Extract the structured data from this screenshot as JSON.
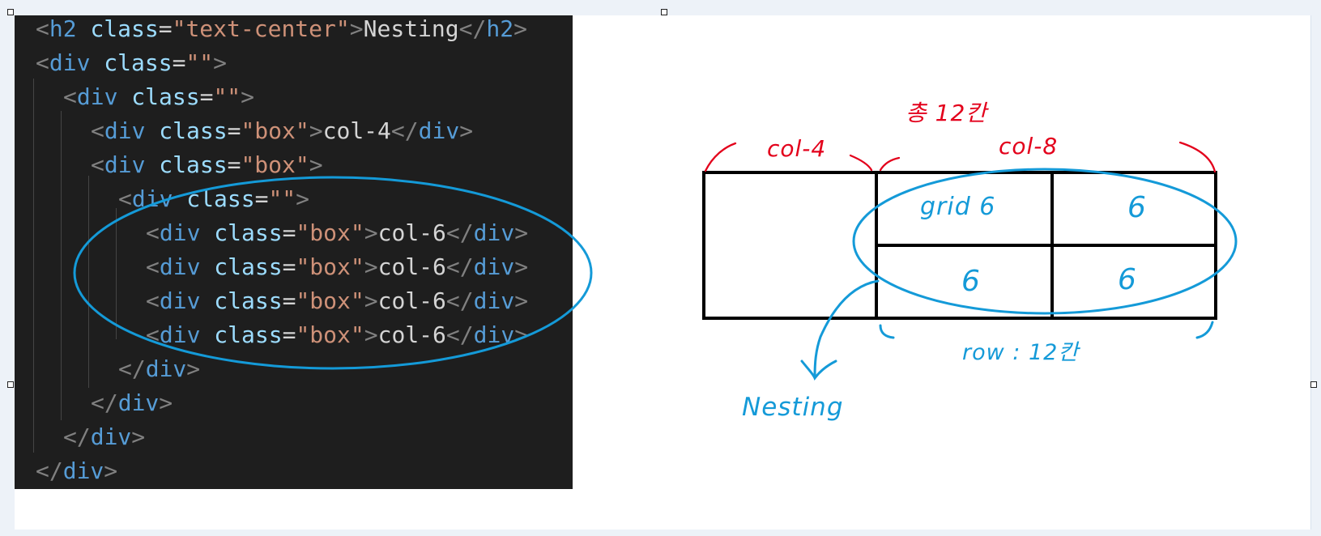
{
  "code": {
    "lines": [
      {
        "indent": 0,
        "tokens": [
          {
            "text": "<",
            "kind": "p"
          },
          {
            "text": "h2",
            "kind": "t"
          },
          {
            "text": " ",
            "kind": "x"
          },
          {
            "text": "class",
            "kind": "a"
          },
          {
            "text": "=",
            "kind": "x"
          },
          {
            "text": "\"text-center\"",
            "kind": "s"
          },
          {
            "text": ">",
            "kind": "p"
          },
          {
            "text": "Nesting",
            "kind": "x"
          },
          {
            "text": "</",
            "kind": "p"
          },
          {
            "text": "h2",
            "kind": "t"
          },
          {
            "text": ">",
            "kind": "p"
          }
        ]
      },
      {
        "indent": 0,
        "tokens": [
          {
            "text": "<",
            "kind": "p"
          },
          {
            "text": "div",
            "kind": "t"
          },
          {
            "text": " ",
            "kind": "x"
          },
          {
            "text": "class",
            "kind": "a"
          },
          {
            "text": "=",
            "kind": "x"
          },
          {
            "text": "\"\"",
            "kind": "s"
          },
          {
            "text": ">",
            "kind": "p"
          }
        ]
      },
      {
        "indent": 1,
        "tokens": [
          {
            "text": "<",
            "kind": "p"
          },
          {
            "text": "div",
            "kind": "t"
          },
          {
            "text": " ",
            "kind": "x"
          },
          {
            "text": "class",
            "kind": "a"
          },
          {
            "text": "=",
            "kind": "x"
          },
          {
            "text": "\"\"",
            "kind": "s"
          },
          {
            "text": ">",
            "kind": "p"
          }
        ]
      },
      {
        "indent": 2,
        "tokens": [
          {
            "text": "<",
            "kind": "p"
          },
          {
            "text": "div",
            "kind": "t"
          },
          {
            "text": " ",
            "kind": "x"
          },
          {
            "text": "class",
            "kind": "a"
          },
          {
            "text": "=",
            "kind": "x"
          },
          {
            "text": "\"box\"",
            "kind": "s"
          },
          {
            "text": ">",
            "kind": "p"
          },
          {
            "text": "col-4",
            "kind": "x"
          },
          {
            "text": "</",
            "kind": "p"
          },
          {
            "text": "div",
            "kind": "t"
          },
          {
            "text": ">",
            "kind": "p"
          }
        ]
      },
      {
        "indent": 2,
        "tokens": [
          {
            "text": "<",
            "kind": "p"
          },
          {
            "text": "div",
            "kind": "t"
          },
          {
            "text": " ",
            "kind": "x"
          },
          {
            "text": "class",
            "kind": "a"
          },
          {
            "text": "=",
            "kind": "x"
          },
          {
            "text": "\"box\"",
            "kind": "s"
          },
          {
            "text": ">",
            "kind": "p"
          }
        ]
      },
      {
        "indent": 3,
        "tokens": [
          {
            "text": "<",
            "kind": "p"
          },
          {
            "text": "div",
            "kind": "t"
          },
          {
            "text": " ",
            "kind": "x"
          },
          {
            "text": "class",
            "kind": "a"
          },
          {
            "text": "=",
            "kind": "x"
          },
          {
            "text": "\"\"",
            "kind": "s"
          },
          {
            "text": ">",
            "kind": "p"
          }
        ]
      },
      {
        "indent": 4,
        "tokens": [
          {
            "text": "<",
            "kind": "p"
          },
          {
            "text": "div",
            "kind": "t"
          },
          {
            "text": " ",
            "kind": "x"
          },
          {
            "text": "class",
            "kind": "a"
          },
          {
            "text": "=",
            "kind": "x"
          },
          {
            "text": "\"box\"",
            "kind": "s"
          },
          {
            "text": ">",
            "kind": "p"
          },
          {
            "text": "col-6",
            "kind": "x"
          },
          {
            "text": "</",
            "kind": "p"
          },
          {
            "text": "div",
            "kind": "t"
          },
          {
            "text": ">",
            "kind": "p"
          }
        ]
      },
      {
        "indent": 4,
        "tokens": [
          {
            "text": "<",
            "kind": "p"
          },
          {
            "text": "div",
            "kind": "t"
          },
          {
            "text": " ",
            "kind": "x"
          },
          {
            "text": "class",
            "kind": "a"
          },
          {
            "text": "=",
            "kind": "x"
          },
          {
            "text": "\"box\"",
            "kind": "s"
          },
          {
            "text": ">",
            "kind": "p"
          },
          {
            "text": "col-6",
            "kind": "x"
          },
          {
            "text": "</",
            "kind": "p"
          },
          {
            "text": "div",
            "kind": "t"
          },
          {
            "text": ">",
            "kind": "p"
          }
        ]
      },
      {
        "indent": 4,
        "tokens": [
          {
            "text": "<",
            "kind": "p"
          },
          {
            "text": "div",
            "kind": "t"
          },
          {
            "text": " ",
            "kind": "x"
          },
          {
            "text": "class",
            "kind": "a"
          },
          {
            "text": "=",
            "kind": "x"
          },
          {
            "text": "\"box\"",
            "kind": "s"
          },
          {
            "text": ">",
            "kind": "p"
          },
          {
            "text": "col-6",
            "kind": "x"
          },
          {
            "text": "</",
            "kind": "p"
          },
          {
            "text": "div",
            "kind": "t"
          },
          {
            "text": ">",
            "kind": "p"
          }
        ]
      },
      {
        "indent": 4,
        "tokens": [
          {
            "text": "<",
            "kind": "p"
          },
          {
            "text": "div",
            "kind": "t"
          },
          {
            "text": " ",
            "kind": "x"
          },
          {
            "text": "class",
            "kind": "a"
          },
          {
            "text": "=",
            "kind": "x"
          },
          {
            "text": "\"box\"",
            "kind": "s"
          },
          {
            "text": ">",
            "kind": "p"
          },
          {
            "text": "col-6",
            "kind": "x"
          },
          {
            "text": "</",
            "kind": "p"
          },
          {
            "text": "div",
            "kind": "t"
          },
          {
            "text": ">",
            "kind": "p"
          }
        ]
      },
      {
        "indent": 3,
        "tokens": [
          {
            "text": "</",
            "kind": "p"
          },
          {
            "text": "div",
            "kind": "t"
          },
          {
            "text": ">",
            "kind": "p"
          }
        ]
      },
      {
        "indent": 2,
        "tokens": [
          {
            "text": "</",
            "kind": "p"
          },
          {
            "text": "div",
            "kind": "t"
          },
          {
            "text": ">",
            "kind": "p"
          }
        ]
      },
      {
        "indent": 1,
        "tokens": [
          {
            "text": "</",
            "kind": "p"
          },
          {
            "text": "div",
            "kind": "t"
          },
          {
            "text": ">",
            "kind": "p"
          }
        ]
      },
      {
        "indent": 0,
        "tokens": [
          {
            "text": "</",
            "kind": "p"
          },
          {
            "text": "div",
            "kind": "t"
          },
          {
            "text": ">",
            "kind": "p"
          }
        ]
      }
    ]
  },
  "annotations": {
    "total_label": "총 12칸",
    "col4_label": "col-4",
    "col8_label": "col-8",
    "cell_grid6": "grid 6",
    "cell_six_a": "6",
    "cell_six_b": "6",
    "cell_six_c": "6",
    "row_label": "row : 12칸",
    "nesting_label": "Nesting"
  },
  "colors": {
    "editor_background": "#1e1e1e",
    "red_ink": "#e3001b",
    "blue_ink": "#149ad8"
  }
}
